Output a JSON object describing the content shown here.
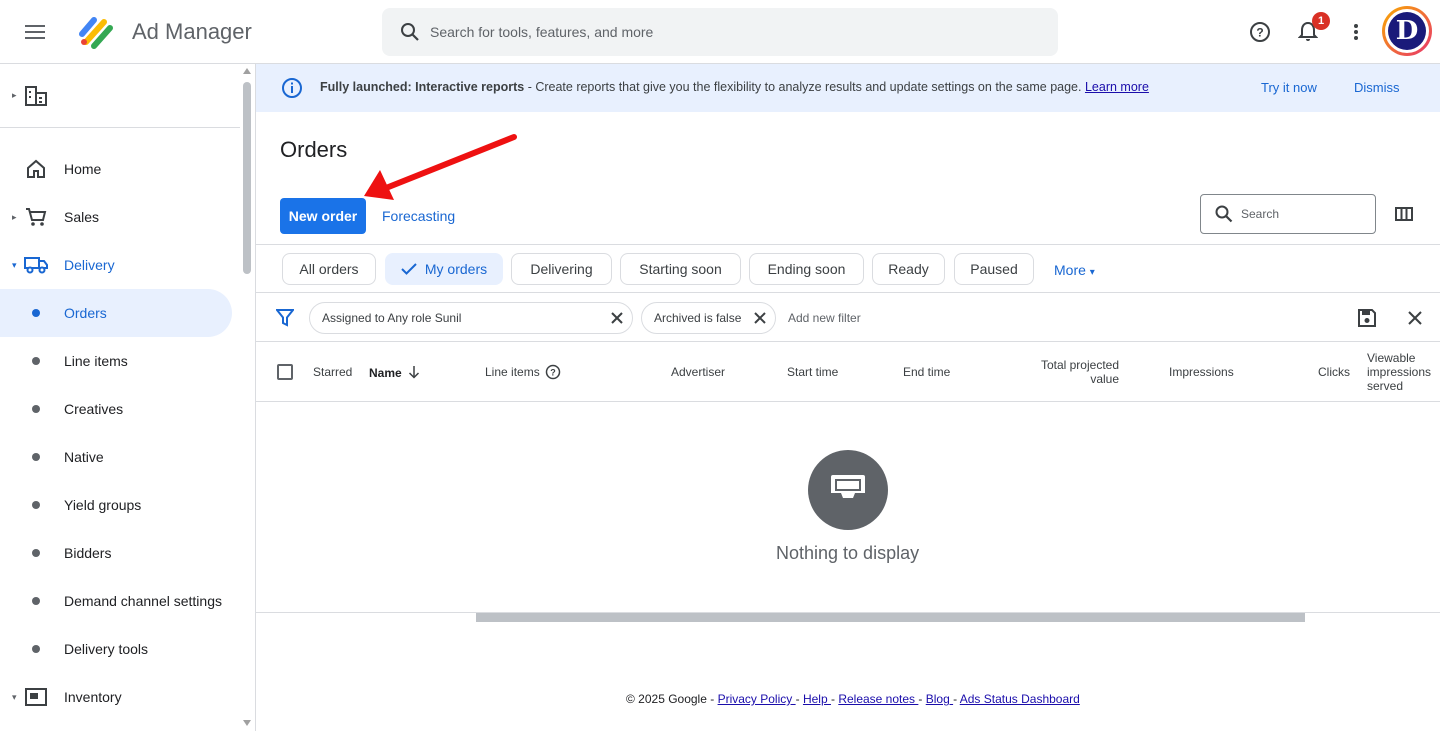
{
  "app": {
    "name": "Ad Manager"
  },
  "search": {
    "placeholder": "Search for tools, features, and more"
  },
  "notifications": {
    "count": "1"
  },
  "avatar": {
    "letter": "D"
  },
  "sidebar": {
    "items": [
      {
        "label": "Home",
        "icon": "home-icon"
      },
      {
        "label": "Sales",
        "icon": "cart-icon"
      },
      {
        "label": "Delivery",
        "icon": "truck-icon"
      },
      {
        "label": "Orders"
      },
      {
        "label": "Line items"
      },
      {
        "label": "Creatives"
      },
      {
        "label": "Native"
      },
      {
        "label": "Yield groups"
      },
      {
        "label": "Bidders"
      },
      {
        "label": "Demand channel settings"
      },
      {
        "label": "Delivery tools"
      },
      {
        "label": "Inventory",
        "icon": "inventory-icon"
      }
    ]
  },
  "banner": {
    "bold": "Fully launched: Interactive reports",
    "text": " - Create reports that give you the flexibility to analyze results and update settings on the same page. ",
    "link": "Learn more",
    "try_label": "Try it now",
    "dismiss_label": "Dismiss"
  },
  "page": {
    "title": "Orders",
    "new_order_label": "New order",
    "forecasting_label": "Forecasting",
    "search_placeholder": "Search"
  },
  "chips": [
    "All orders",
    "My orders",
    "Delivering",
    "Starting soon",
    "Ending soon",
    "Ready",
    "Paused"
  ],
  "more_label": "More",
  "filters": {
    "chip1": "Assigned to Any role Sunil",
    "chip2": "Archived is false",
    "add_placeholder": "Add new filter"
  },
  "table": {
    "headers": {
      "starred": "Starred",
      "name": "Name",
      "line_items": "Line items",
      "advertiser": "Advertiser",
      "start_time": "Start time",
      "end_time": "End time",
      "total_projected_value_1": "Total projected",
      "total_projected_value_2": "value",
      "impressions": "Impressions",
      "clicks": "Clicks",
      "viewable_1": "Viewable",
      "viewable_2": "impressions",
      "viewable_3": "served"
    },
    "empty_text": "Nothing to display"
  },
  "footer": {
    "copyright": "© 2025 Google - ",
    "privacy": "Privacy Policy ",
    "help": "Help ",
    "release_notes": "Release notes ",
    "blog": "Blog ",
    "status": "Ads Status Dashboard",
    "sep": "- "
  },
  "colors": {
    "accent": "#1a73e8",
    "banner_bg": "#e8f0fe",
    "annotation_arrow": "#ee1111"
  }
}
